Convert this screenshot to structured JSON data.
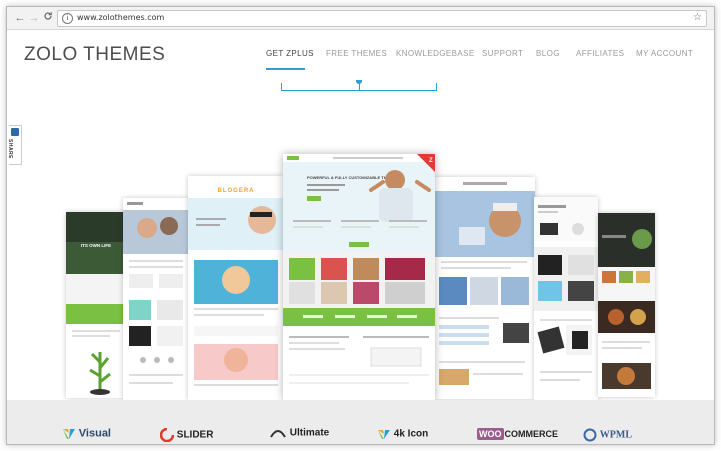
{
  "browser": {
    "url": "www.zolothemes.com",
    "back_icon": "←",
    "forward_icon": "→",
    "reload_icon": "C",
    "info_icon": "i",
    "star_icon": "☆"
  },
  "site": {
    "logo": "ZOLO THEMES",
    "menu": [
      {
        "label": "GET ZPLUS",
        "active": true
      },
      {
        "label": "FREE THEMES",
        "active": false
      },
      {
        "label": "KNOWLEDGEBASE",
        "active": false
      },
      {
        "label": "SUPPORT",
        "active": false
      },
      {
        "label": "BLOG",
        "active": false
      },
      {
        "label": "AFFILIATES",
        "active": false
      },
      {
        "label": "MY ACCOUNT",
        "active": false
      }
    ],
    "share_label": "SHARE",
    "accent_color": "#2a9fd6"
  },
  "showcase": {
    "center_card": {
      "tagline": "POWERFUL & FULLY CUSTOMIZABLE THEME",
      "badge": "Z"
    },
    "left_card_heading": "ITS OWN LIFE",
    "card_brand": "BLOGERA"
  },
  "plugins": [
    {
      "name": "Visual Composer",
      "label": "Visual"
    },
    {
      "name": "Slider Revolution",
      "label": "SLIDER"
    },
    {
      "name": "Ultimate",
      "label": "Ultimate"
    },
    {
      "name": "4k Icon",
      "label": "4k Icon"
    },
    {
      "name": "WooCommerce",
      "label": "COMMERCE",
      "prefix": "WOO"
    },
    {
      "name": "WPML",
      "label": "WPML"
    }
  ]
}
